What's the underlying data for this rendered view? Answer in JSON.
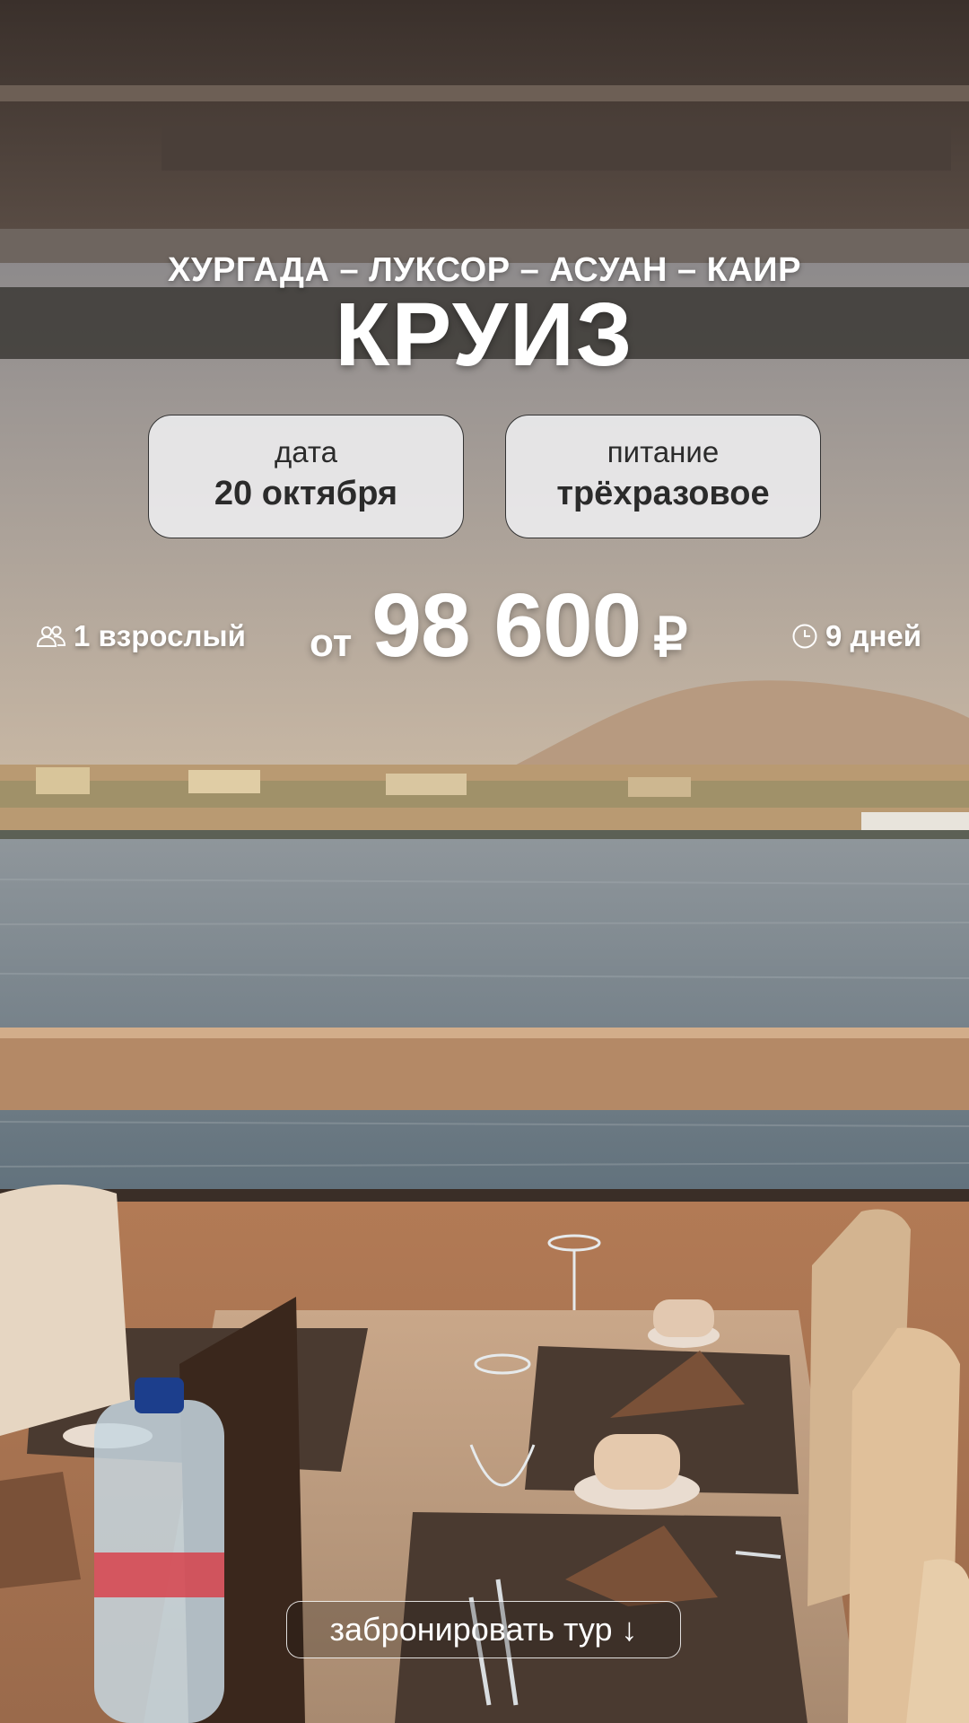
{
  "hero": {
    "route": "ХУРГАДА – ЛУКСОР – АСУАН – КАИР",
    "title": "КРУИЗ"
  },
  "cards": {
    "date": {
      "label": "дата",
      "value": "20 октября"
    },
    "meals": {
      "label": "питание",
      "value": "трёхразовое"
    }
  },
  "meta": {
    "adults": "1 взрослый",
    "adults_icon": "people-icon",
    "duration": "9 дней",
    "duration_icon": "clock-icon"
  },
  "price": {
    "from": "от",
    "amount": "98 600",
    "currency": "₽"
  },
  "cta": {
    "label": "забронировать тур",
    "arrow": "↓"
  },
  "colors": {
    "card_bg": "#eeeef0",
    "card_text": "#2b2b2b",
    "overlay_text": "#ffffff"
  }
}
